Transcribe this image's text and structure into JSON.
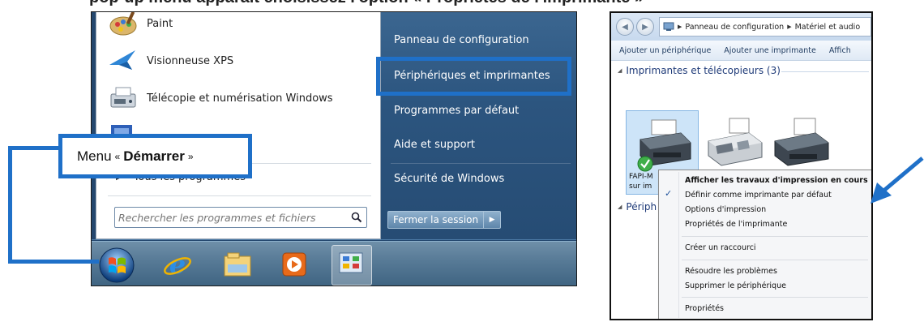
{
  "caption": {
    "text": "pop-up menu apparaît choisissez l'option « Propriétés de l'imprimante »"
  },
  "start_menu": {
    "programs": [
      {
        "label": "Paint",
        "icon": "paint-icon"
      },
      {
        "label": "Visionneuse XPS",
        "icon": "xps-viewer-icon"
      },
      {
        "label": "Télécopie et numérisation Windows",
        "icon": "fax-scan-icon"
      },
      {
        "label": "",
        "icon": "app-icon"
      }
    ],
    "all_programs": "Tous les programmes",
    "search_placeholder": "Rechercher les programmes et fichiers",
    "right_items": [
      "Panneau de configuration",
      "Périphériques et imprimantes",
      "Programmes par défaut",
      "Aide et support",
      "Sécurité de Windows"
    ],
    "shutdown_label": "Fermer la session",
    "taskbar_icons": [
      "start-orb-icon",
      "internet-explorer-icon",
      "file-explorer-icon",
      "media-player-icon",
      "control-panel-icon"
    ]
  },
  "callout": {
    "prefix": "Menu",
    "open_quote": "«",
    "bold": "Démarrer",
    "close_quote": "»"
  },
  "explorer": {
    "breadcrumb": [
      "Panneau de configuration",
      "Matériel et audio"
    ],
    "toolbar": [
      "Ajouter un périphérique",
      "Ajouter une imprimante",
      "Affich"
    ],
    "group_printers": "Imprimantes et télécopieurs (3)",
    "group_devices": "Périph",
    "device_label_1": "FAPI-M",
    "device_label_2": "sur im",
    "context_menu": [
      {
        "label": "Afficher les travaux d'impression en cours",
        "bold": true
      },
      {
        "label": "Définir comme imprimante par défaut",
        "checked": true
      },
      {
        "label": "Options d'impression"
      },
      {
        "label": "Propriétés de l'imprimante"
      },
      {
        "label": "Créer un raccourci"
      },
      {
        "label": "Résoudre les problèmes"
      },
      {
        "label": "Supprimer le périphérique"
      },
      {
        "label": "Propriétés"
      }
    ]
  },
  "colors": {
    "accent": "#1f70c8",
    "start_menu_right": "#2c557f",
    "selection": "#cde4f8"
  }
}
